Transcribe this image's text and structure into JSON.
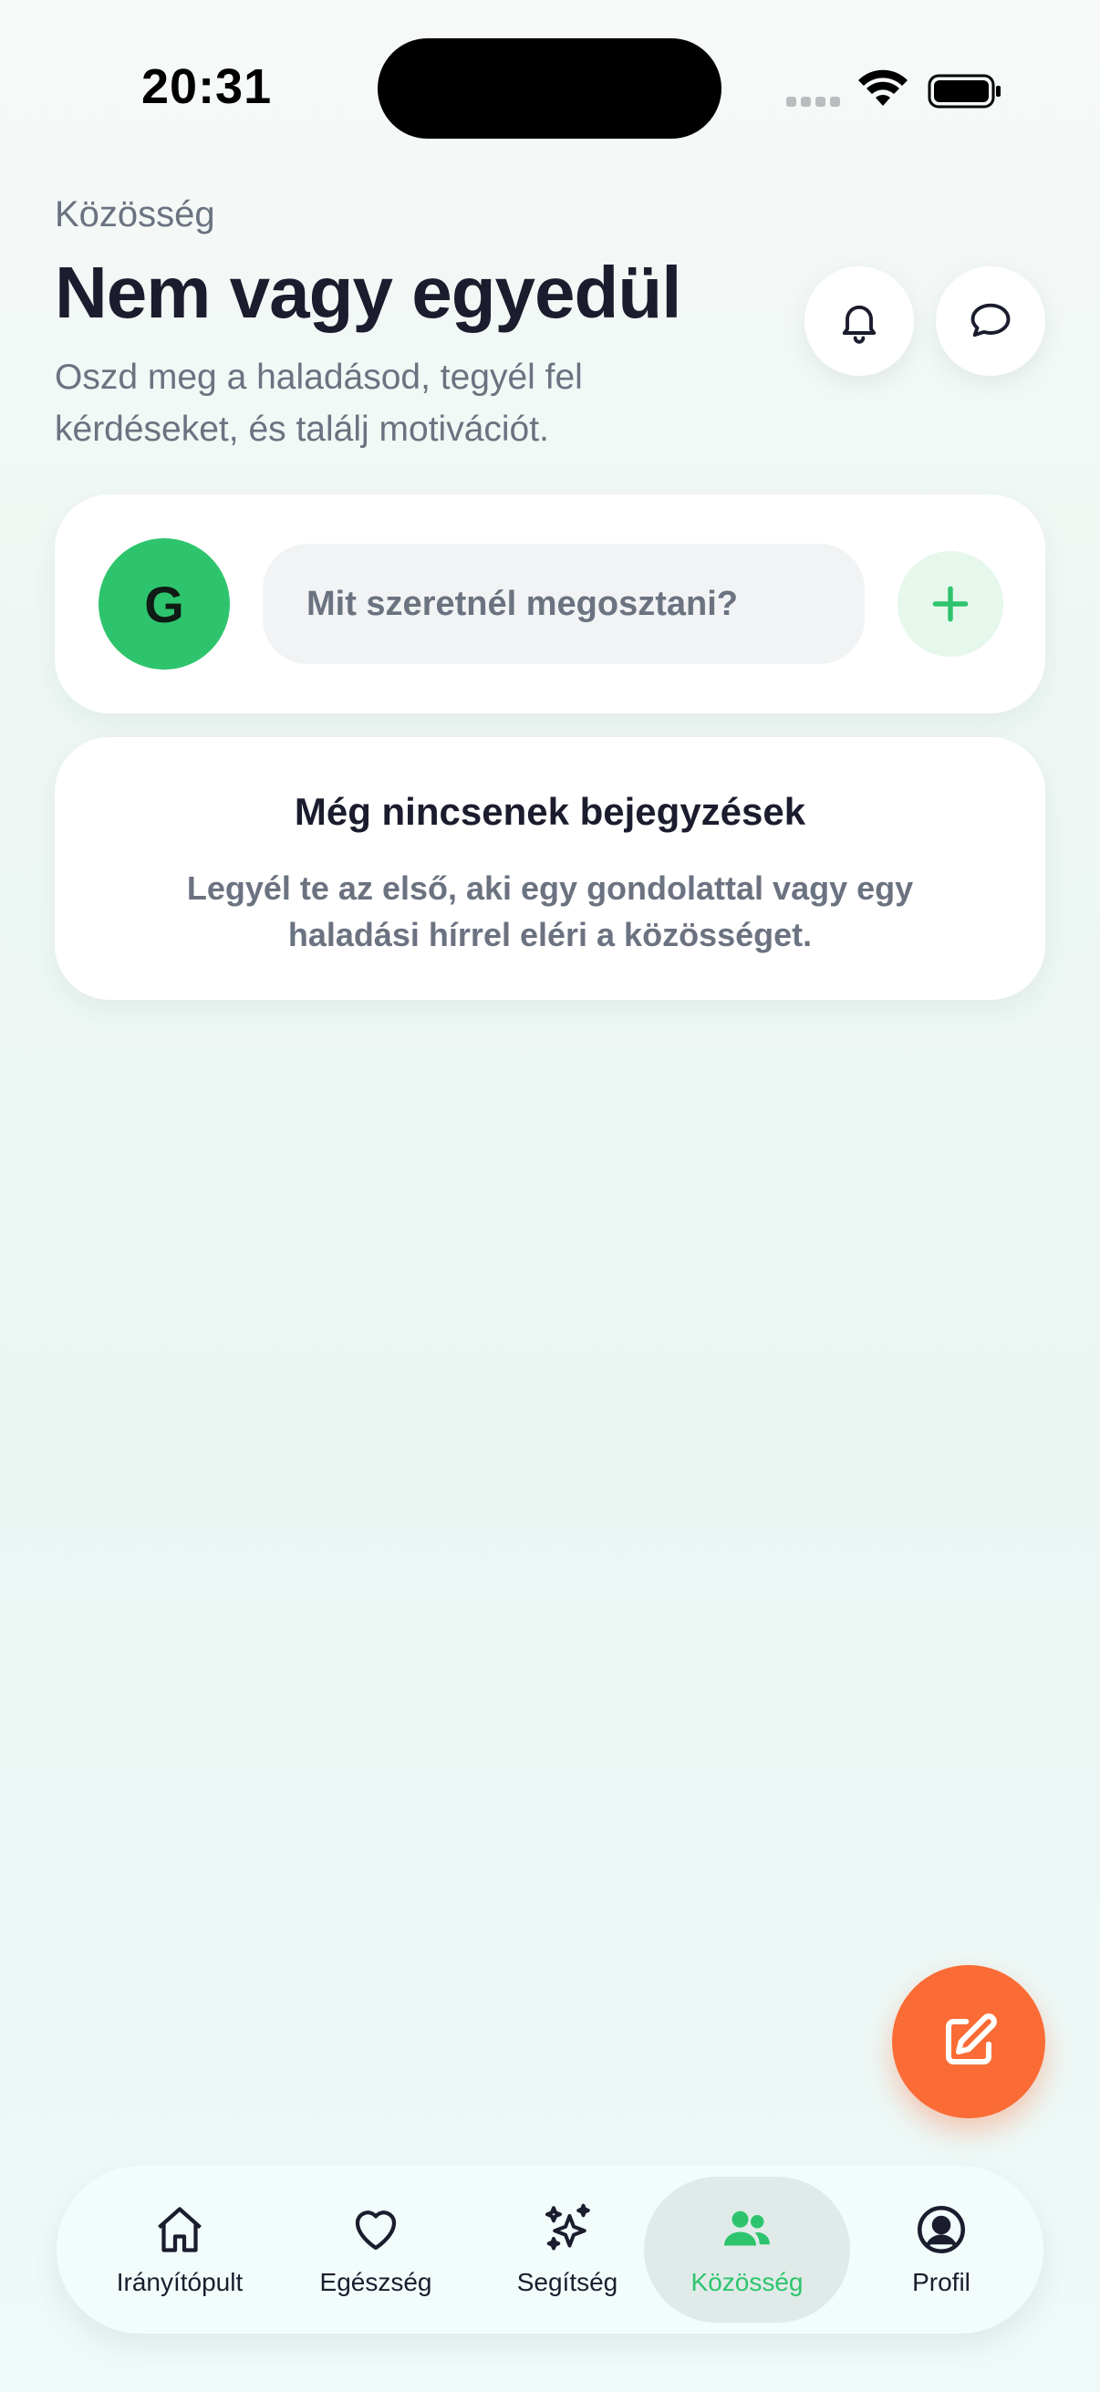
{
  "status_bar": {
    "time": "20:31"
  },
  "header": {
    "eyebrow": "Közösség",
    "title": "Nem vagy egyedül",
    "subtitle": "Oszd meg a haladásod, tegyél fel kérdéseket, és találj motivációt.",
    "icons": [
      "bell-icon",
      "chat-bubble-icon"
    ]
  },
  "composer": {
    "avatar_initial": "G",
    "placeholder": "Mit szeretnél megosztani?",
    "add_icon": "plus-icon"
  },
  "empty_state": {
    "title": "Még nincsenek bejegyzések",
    "text": "Legyél te az első, aki egy gondolattal vagy egy haladási hírrel eléri a közösséget."
  },
  "fab": {
    "icon": "edit-icon"
  },
  "bottom_nav": {
    "items": [
      {
        "label": "Irányítópult",
        "icon": "home-icon",
        "active": false
      },
      {
        "label": "Egészség",
        "icon": "heart-icon",
        "active": false
      },
      {
        "label": "Segítség",
        "icon": "sparkles-icon",
        "active": false
      },
      {
        "label": "Közösség",
        "icon": "users-icon",
        "active": true
      },
      {
        "label": "Profil",
        "icon": "user-circle-icon",
        "active": false
      }
    ]
  },
  "colors": {
    "accent_green": "#2ec46d",
    "fab_orange": "#fb6b35",
    "text_dark": "#1b1d2e",
    "text_muted": "#6b7280"
  }
}
